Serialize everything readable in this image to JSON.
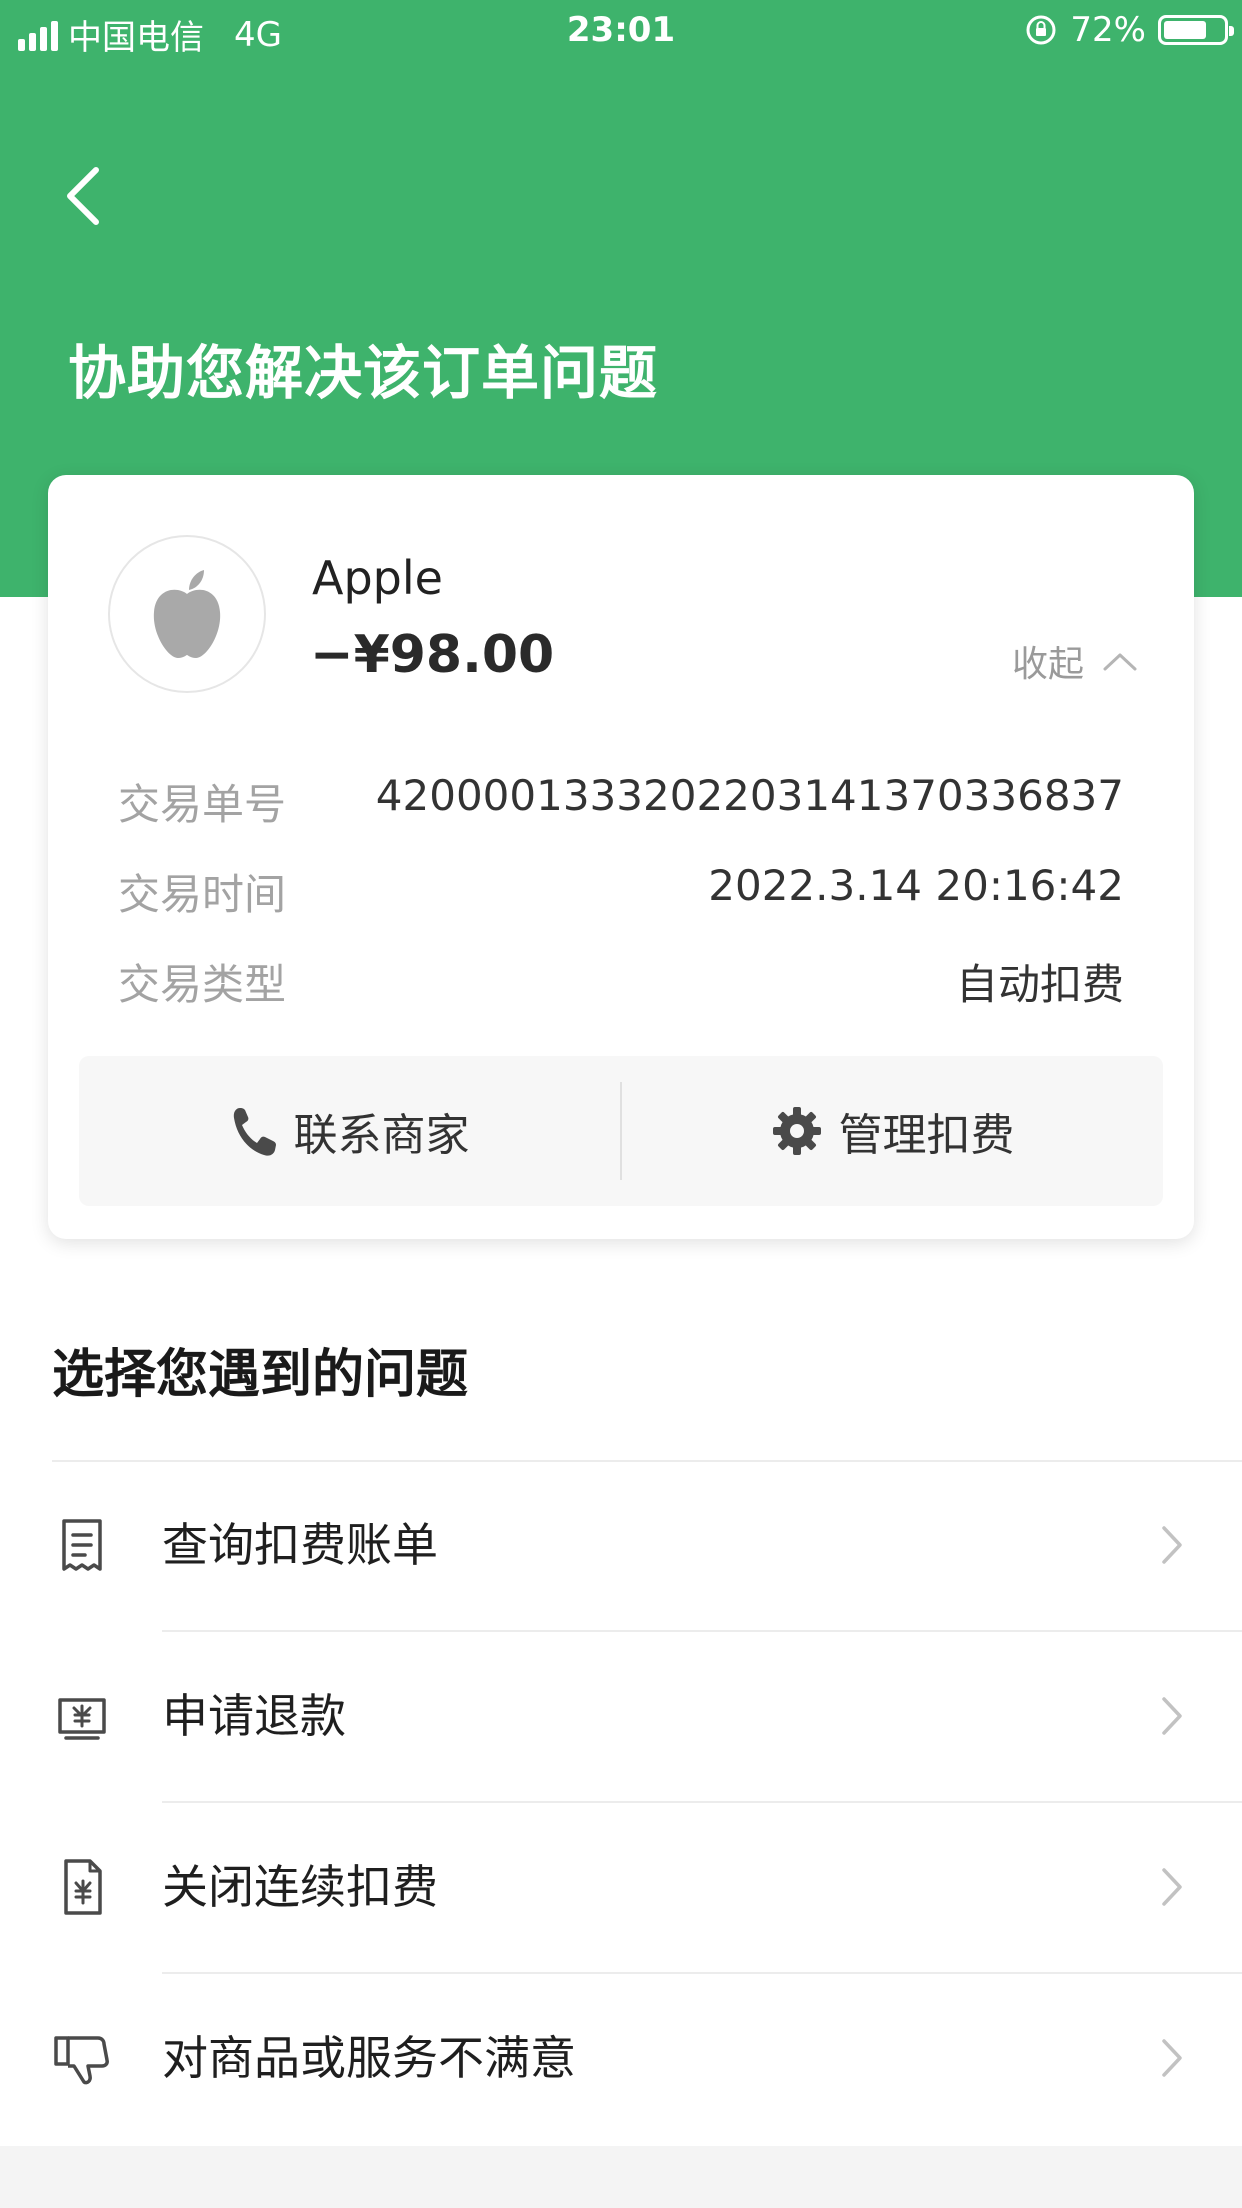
{
  "status_bar": {
    "carrier": "中国电信",
    "network": "4G",
    "time": "23:01",
    "battery": "72%",
    "battery_level": 0.72
  },
  "header": {
    "title": "协助您解决该订单问题"
  },
  "order": {
    "merchant": "Apple",
    "amount": "−¥98.00",
    "collapse_label": "收起",
    "details": [
      {
        "label": "交易单号",
        "value": "4200001333202203141370336837"
      },
      {
        "label": "交易时间",
        "value": "2022.3.14 20:16:42"
      },
      {
        "label": "交易类型",
        "value": "自动扣费"
      }
    ],
    "actions": {
      "contact": "联系商家",
      "manage": "管理扣费"
    }
  },
  "questions": {
    "title": "选择您遇到的问题",
    "items": [
      {
        "label": "查询扣费账单",
        "icon": "receipt-icon"
      },
      {
        "label": "申请退款",
        "icon": "refund-icon"
      },
      {
        "label": "关闭连续扣费",
        "icon": "document-yuan-icon"
      },
      {
        "label": "对商品或服务不满意",
        "icon": "thumbs-down-icon"
      }
    ]
  },
  "colors": {
    "brand_green": "#3eb36c"
  }
}
